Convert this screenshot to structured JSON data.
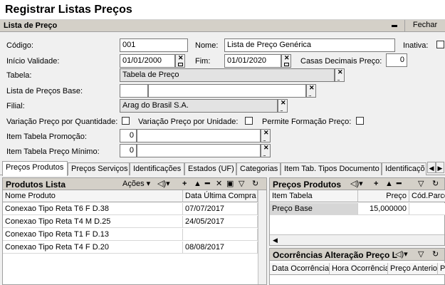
{
  "window": {
    "title": "Registrar Listas Preços"
  },
  "panel": {
    "title": "Lista de Preço",
    "close_label": "Fechar"
  },
  "form": {
    "codigo_label": "Código:",
    "codigo_value": "001",
    "nome_label": "Nome:",
    "nome_value": "Lista de Preço Genérica",
    "inativa_label": "Inativa:",
    "inicio_label": "Início Validade:",
    "inicio_value": "01/01/2000",
    "fim_label": "Fim:",
    "fim_value": "01/01/2020",
    "casas_label": "Casas Decimais Preço:",
    "casas_value": "0",
    "tabela_label": "Tabela:",
    "tabela_value": "Tabela de Preço",
    "lista_base_label": "Lista de Preços Base:",
    "filial_label": "Filial:",
    "filial_value": "Arag do Brasil S.A.",
    "var_qtd_label": "Variação Preço por Quantidade:",
    "var_un_label": "Variação Preço por Unidade:",
    "permite_label": "Permite Formação Preço:",
    "promo_label": "Item Tabela Promoção:",
    "promo_value": "0",
    "minimo_label": "Item Tabela Preço Mínimo:",
    "minimo_value": "0"
  },
  "tabs": [
    "Preços Produtos",
    "Preços Serviços",
    "Identificações",
    "Estados (UF)",
    "Categorias",
    "Item Tab. Tipos Documento",
    "Identificaçõ"
  ],
  "produtos": {
    "title": "Produtos Lista",
    "actions_label": "Ações",
    "columns": [
      "Nome Produto",
      "Data Última Compra"
    ],
    "rows": [
      [
        "Conexao Tipo Reta T6 F D.38",
        "07/07/2017"
      ],
      [
        "Conexao Tipo Reta T4 M D.25",
        "24/05/2017"
      ],
      [
        "Conexao Tipo Reta T1 F D.13",
        ""
      ],
      [
        "Conexao Tipo Reta T4 F D.20",
        "08/08/2017"
      ]
    ]
  },
  "precos": {
    "title": "Preços Produtos",
    "columns": [
      "Item Tabela",
      "Preço",
      "Cód.Parce"
    ],
    "rows": [
      [
        "Preço Base",
        "15,000000",
        ""
      ]
    ]
  },
  "ocorrencias": {
    "title": "Ocorrências Alteração Preço L",
    "columns": [
      "Data Ocorrência",
      "Hora Ocorrência",
      "Preço Anterior",
      "P"
    ]
  }
}
